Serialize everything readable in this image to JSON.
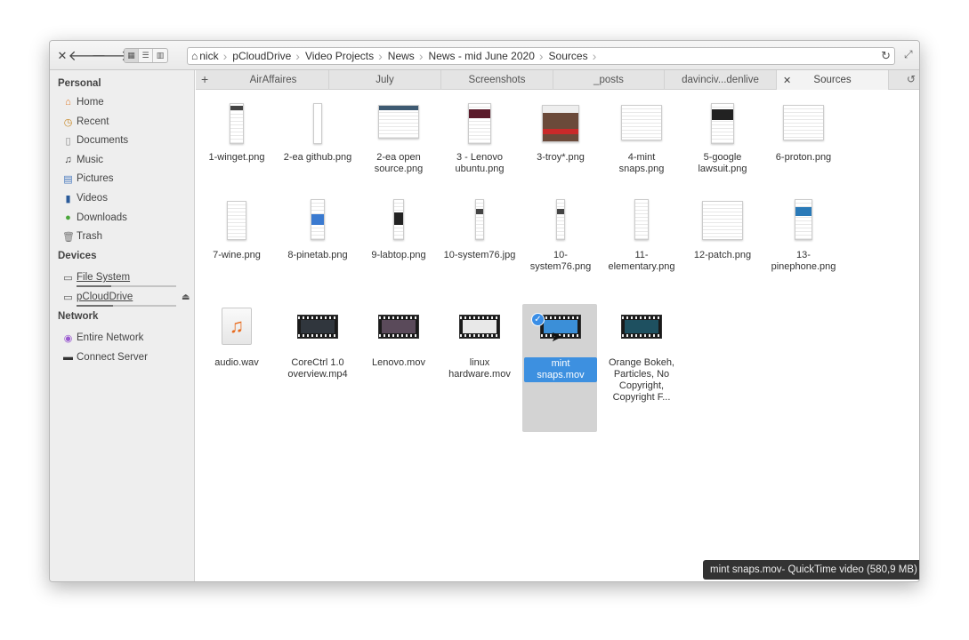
{
  "window": {
    "close_icon": "close-icon",
    "back_icon": "back-arrow-icon",
    "forward_icon": "forward-arrow-icon",
    "view_modes": [
      "icon-view",
      "list-view",
      "column-view"
    ],
    "active_view": "icon-view"
  },
  "pathbar": {
    "crumbs": [
      "nick",
      "pCloudDrive",
      "Video Projects",
      "News",
      "News - mid June 2020",
      "Sources"
    ]
  },
  "sidebar": {
    "personal_heading": "Personal",
    "personal": [
      {
        "label": "Home",
        "icon": "home-icon"
      },
      {
        "label": "Recent",
        "icon": "recent-icon"
      },
      {
        "label": "Documents",
        "icon": "documents-icon"
      },
      {
        "label": "Music",
        "icon": "music-icon"
      },
      {
        "label": "Pictures",
        "icon": "pictures-icon"
      },
      {
        "label": "Videos",
        "icon": "videos-icon"
      },
      {
        "label": "Downloads",
        "icon": "downloads-icon"
      },
      {
        "label": "Trash",
        "icon": "trash-icon"
      }
    ],
    "devices_heading": "Devices",
    "devices": [
      {
        "label": "File System",
        "usage_fraction": 0.35
      },
      {
        "label": "pCloudDrive",
        "usage_fraction": 0.37
      }
    ],
    "network_heading": "Network",
    "network": [
      {
        "label": "Entire Network",
        "icon": "network-icon"
      },
      {
        "label": "Connect Server",
        "icon": "server-icon"
      }
    ]
  },
  "tabs": [
    "AirAffaires",
    "July",
    "Screenshots",
    "_posts",
    "davinciv...denlive",
    "Sources"
  ],
  "active_tab": "Sources",
  "files": {
    "row1": [
      "1-winget.png",
      "2-ea github.png",
      "2-ea open source.png",
      "3 - Lenovo ubuntu.png",
      "3-troy*.png",
      "4-mint snaps.png",
      "5-google lawsuit.png",
      "6-proton.png"
    ],
    "row2": [
      "7-wine.png",
      "8-pinetab.png",
      "9-labtop.png",
      "10-system76.jpg",
      "10-system76.png",
      "11-elementary.png",
      "12-patch.png",
      "13-pinephone.png"
    ],
    "row3": [
      "audio.wav",
      "CoreCtrl 1.0 overview.mp4",
      "Lenovo.mov",
      "linux hardware.mov",
      "mint snaps.mov",
      "Orange Bokeh, Particles, No Copyright, Copyright F..."
    ]
  },
  "selected_file": "mint snaps.mov",
  "tooltip": "mint snaps.mov- QuickTime video (580,9 MB)"
}
